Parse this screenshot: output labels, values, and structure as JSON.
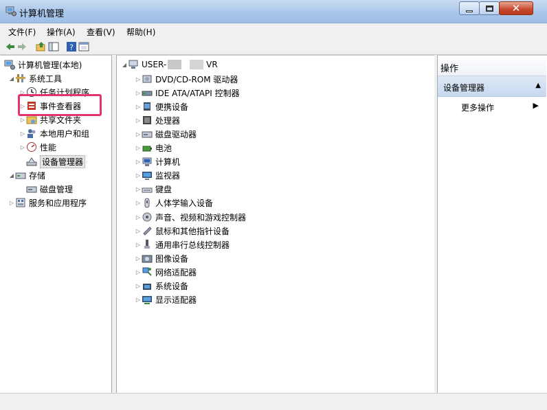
{
  "window": {
    "title": "计算机管理"
  },
  "menu": [
    "文件(F)",
    "操作(A)",
    "查看(V)",
    "帮助(H)"
  ],
  "toolbar": [
    "back-icon",
    "forward-icon",
    "up-folder-icon",
    "show-hide-tree-icon",
    "help-icon",
    "properties-icon"
  ],
  "left_tree": {
    "root": "计算机管理(本地)",
    "system_tools": "系统工具",
    "task_scheduler": "任务计划程序",
    "event_viewer": "事件查看器",
    "shared_folders": "共享文件夹",
    "local_users": "本地用户和组",
    "performance": "性能",
    "device_manager": "设备管理器",
    "storage": "存储",
    "disk_management": "磁盘管理",
    "services_apps": "服务和应用程序"
  },
  "center": {
    "computer_name_prefix": "USER-",
    "computer_name_suffix": "VR",
    "categories": [
      "DVD/CD-ROM 驱动器",
      "IDE ATA/ATAPI 控制器",
      "便携设备",
      "处理器",
      "磁盘驱动器",
      "电池",
      "计算机",
      "监视器",
      "键盘",
      "人体学输入设备",
      "声音、视频和游戏控制器",
      "鼠标和其他指针设备",
      "通用串行总线控制器",
      "图像设备",
      "网络适配器",
      "系统设备",
      "显示适配器"
    ]
  },
  "actions": {
    "header": "操作",
    "section": "设备管理器",
    "more": "更多操作"
  },
  "highlight_color": "#e6336d"
}
